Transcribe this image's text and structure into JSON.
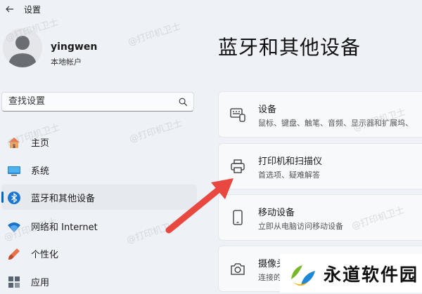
{
  "app": {
    "title": "设置"
  },
  "user": {
    "name": "yingwen",
    "account": "本地帐户"
  },
  "search": {
    "placeholder": "查找设置"
  },
  "nav": {
    "items": [
      {
        "label": "主页",
        "icon": "home-icon"
      },
      {
        "label": "系统",
        "icon": "system-icon"
      },
      {
        "label": "蓝牙和其他设备",
        "icon": "bluetooth-icon",
        "active": true
      },
      {
        "label": "网络和 Internet",
        "icon": "wifi-icon"
      },
      {
        "label": "个性化",
        "icon": "brush-icon"
      },
      {
        "label": "应用",
        "icon": "apps-icon"
      }
    ]
  },
  "page": {
    "title": "蓝牙和其他设备"
  },
  "cards": [
    {
      "title": "设备",
      "subtitle": "鼠标、键盘、触笔、音频、显示器和扩展坞、",
      "icon": "devices-icon"
    },
    {
      "title": "打印机和扫描仪",
      "subtitle": "首选项、疑难解答",
      "icon": "printer-icon"
    },
    {
      "title": "移动设备",
      "subtitle": "立即从电脑访问移动设备",
      "icon": "phone-icon"
    },
    {
      "title": "摄像头",
      "subtitle": "连接的",
      "icon": "camera-icon"
    }
  ],
  "watermark": "@打印机卫士",
  "logo": {
    "text": "永道软件园"
  },
  "colors": {
    "accent": "#0067c0",
    "arrow": "#e8483f",
    "background": "#eef2f6"
  }
}
